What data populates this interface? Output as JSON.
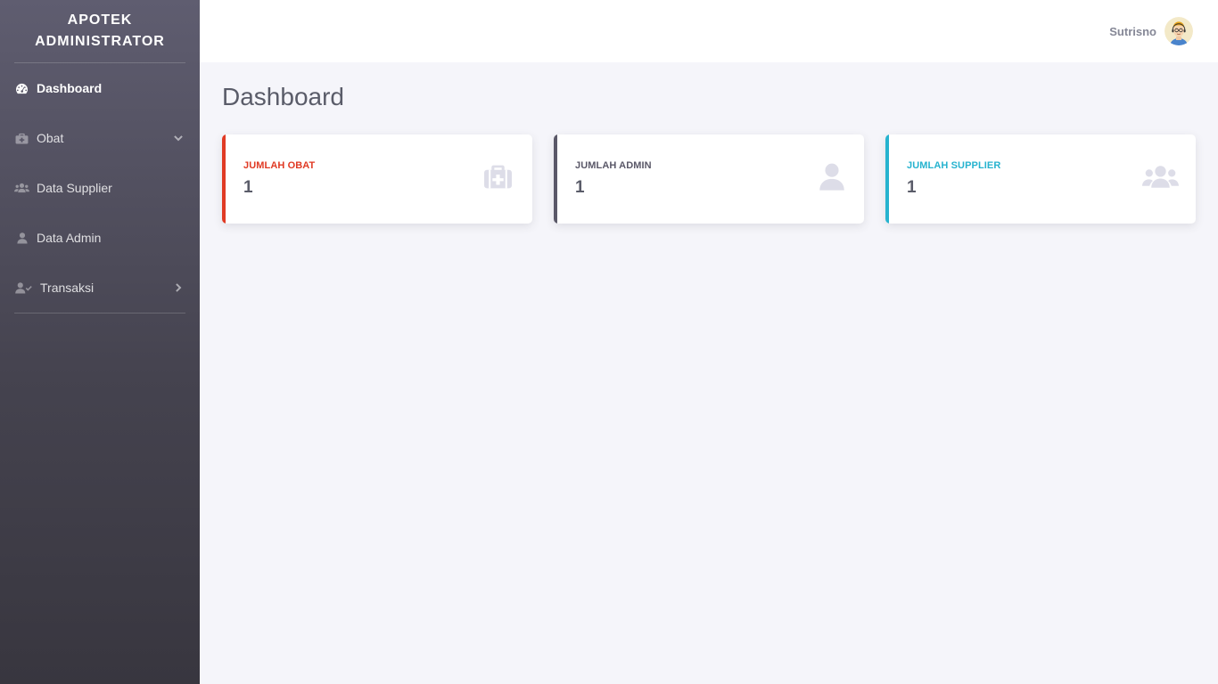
{
  "sidebar": {
    "brand_line1": "APOTEK",
    "brand_line2": "ADMINISTRATOR",
    "items": [
      {
        "label": "Dashboard",
        "icon": "tachometer-icon",
        "active": true
      },
      {
        "label": "Obat",
        "icon": "medkit-icon",
        "chevron": "chevron-down-icon"
      },
      {
        "label": "Data Supplier",
        "icon": "users-icon"
      },
      {
        "label": "Data Admin",
        "icon": "user-icon"
      },
      {
        "label": "Transaksi",
        "icon": "user-check-icon",
        "chevron": "chevron-right-icon"
      }
    ]
  },
  "topbar": {
    "user_name": "Sutrisno",
    "avatar_icon": "user-avatar"
  },
  "main": {
    "title": "Dashboard",
    "cards": [
      {
        "label": "JUMLAH OBAT",
        "value": "1",
        "icon": "medkit-icon",
        "accent": "#e03a24"
      },
      {
        "label": "JUMLAH ADMIN",
        "value": "1",
        "icon": "user-icon",
        "accent": "#5a5868"
      },
      {
        "label": "JUMLAH SUPPLIER",
        "value": "1",
        "icon": "users-icon",
        "accent": "#26b3cf"
      }
    ]
  }
}
